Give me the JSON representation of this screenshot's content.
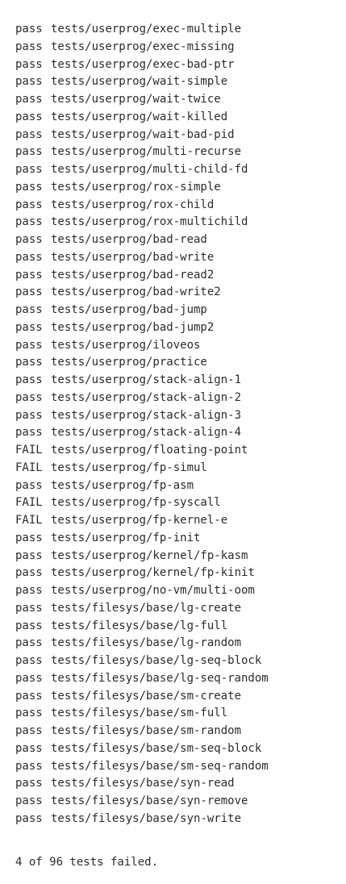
{
  "results": [
    {
      "status": "pass",
      "test": "tests/userprog/exec-multiple"
    },
    {
      "status": "pass",
      "test": "tests/userprog/exec-missing"
    },
    {
      "status": "pass",
      "test": "tests/userprog/exec-bad-ptr"
    },
    {
      "status": "pass",
      "test": "tests/userprog/wait-simple"
    },
    {
      "status": "pass",
      "test": "tests/userprog/wait-twice"
    },
    {
      "status": "pass",
      "test": "tests/userprog/wait-killed"
    },
    {
      "status": "pass",
      "test": "tests/userprog/wait-bad-pid"
    },
    {
      "status": "pass",
      "test": "tests/userprog/multi-recurse"
    },
    {
      "status": "pass",
      "test": "tests/userprog/multi-child-fd"
    },
    {
      "status": "pass",
      "test": "tests/userprog/rox-simple"
    },
    {
      "status": "pass",
      "test": "tests/userprog/rox-child"
    },
    {
      "status": "pass",
      "test": "tests/userprog/rox-multichild"
    },
    {
      "status": "pass",
      "test": "tests/userprog/bad-read"
    },
    {
      "status": "pass",
      "test": "tests/userprog/bad-write"
    },
    {
      "status": "pass",
      "test": "tests/userprog/bad-read2"
    },
    {
      "status": "pass",
      "test": "tests/userprog/bad-write2"
    },
    {
      "status": "pass",
      "test": "tests/userprog/bad-jump"
    },
    {
      "status": "pass",
      "test": "tests/userprog/bad-jump2"
    },
    {
      "status": "pass",
      "test": "tests/userprog/iloveos"
    },
    {
      "status": "pass",
      "test": "tests/userprog/practice"
    },
    {
      "status": "pass",
      "test": "tests/userprog/stack-align-1"
    },
    {
      "status": "pass",
      "test": "tests/userprog/stack-align-2"
    },
    {
      "status": "pass",
      "test": "tests/userprog/stack-align-3"
    },
    {
      "status": "pass",
      "test": "tests/userprog/stack-align-4"
    },
    {
      "status": "FAIL",
      "test": "tests/userprog/floating-point"
    },
    {
      "status": "FAIL",
      "test": "tests/userprog/fp-simul"
    },
    {
      "status": "pass",
      "test": "tests/userprog/fp-asm"
    },
    {
      "status": "FAIL",
      "test": "tests/userprog/fp-syscall"
    },
    {
      "status": "FAIL",
      "test": "tests/userprog/fp-kernel-e"
    },
    {
      "status": "pass",
      "test": "tests/userprog/fp-init"
    },
    {
      "status": "pass",
      "test": "tests/userprog/kernel/fp-kasm"
    },
    {
      "status": "pass",
      "test": "tests/userprog/kernel/fp-kinit"
    },
    {
      "status": "pass",
      "test": "tests/userprog/no-vm/multi-oom"
    },
    {
      "status": "pass",
      "test": "tests/filesys/base/lg-create"
    },
    {
      "status": "pass",
      "test": "tests/filesys/base/lg-full"
    },
    {
      "status": "pass",
      "test": "tests/filesys/base/lg-random"
    },
    {
      "status": "pass",
      "test": "tests/filesys/base/lg-seq-block"
    },
    {
      "status": "pass",
      "test": "tests/filesys/base/lg-seq-random"
    },
    {
      "status": "pass",
      "test": "tests/filesys/base/sm-create"
    },
    {
      "status": "pass",
      "test": "tests/filesys/base/sm-full"
    },
    {
      "status": "pass",
      "test": "tests/filesys/base/sm-random"
    },
    {
      "status": "pass",
      "test": "tests/filesys/base/sm-seq-block"
    },
    {
      "status": "pass",
      "test": "tests/filesys/base/sm-seq-random"
    },
    {
      "status": "pass",
      "test": "tests/filesys/base/syn-read"
    },
    {
      "status": "pass",
      "test": "tests/filesys/base/syn-remove"
    },
    {
      "status": "pass",
      "test": "tests/filesys/base/syn-write"
    }
  ],
  "summary": "4 of 96 tests failed.",
  "colors": {
    "text": "#2b2b2b",
    "background": "#ffffff"
  }
}
